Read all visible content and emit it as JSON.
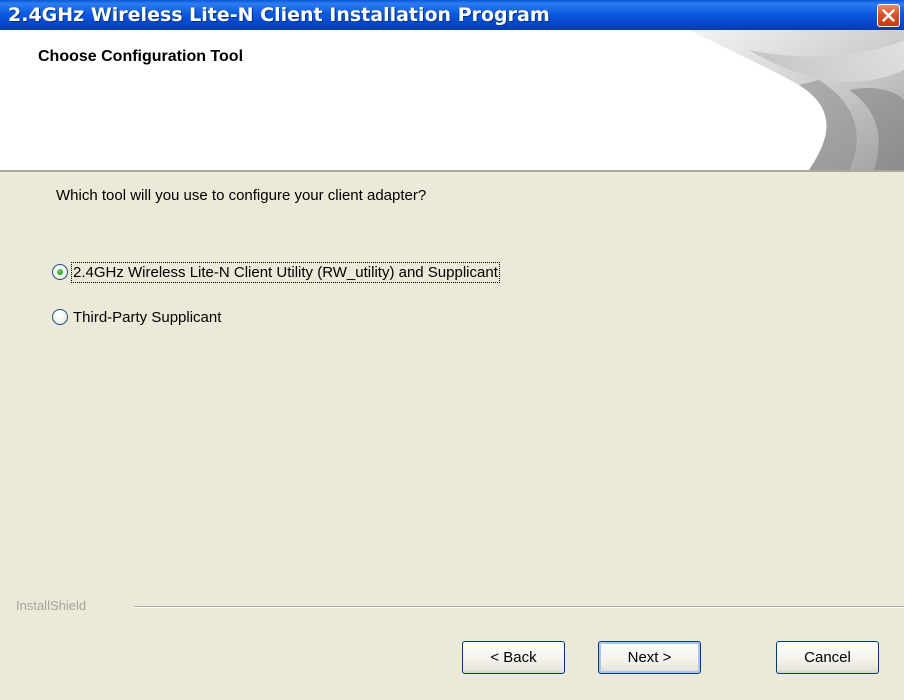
{
  "window": {
    "title": "2.4GHz Wireless Lite-N Client Installation Program"
  },
  "header": {
    "title": "Choose Configuration Tool"
  },
  "body": {
    "question": "Which tool will you use to configure your client adapter?",
    "options": [
      {
        "label": "2.4GHz Wireless Lite-N Client Utility (RW_utility) and Supplicant",
        "selected": true
      },
      {
        "label": "Third-Party Supplicant",
        "selected": false
      }
    ]
  },
  "footer": {
    "brand": "InstallShield",
    "back_label": "< Back",
    "next_label": "Next >",
    "cancel_label": "Cancel"
  },
  "colors": {
    "titlebar": "#0B5BE2",
    "background": "#ECE9D8",
    "close_button": "#D8522C",
    "radio_dot": "#2FA52A"
  }
}
